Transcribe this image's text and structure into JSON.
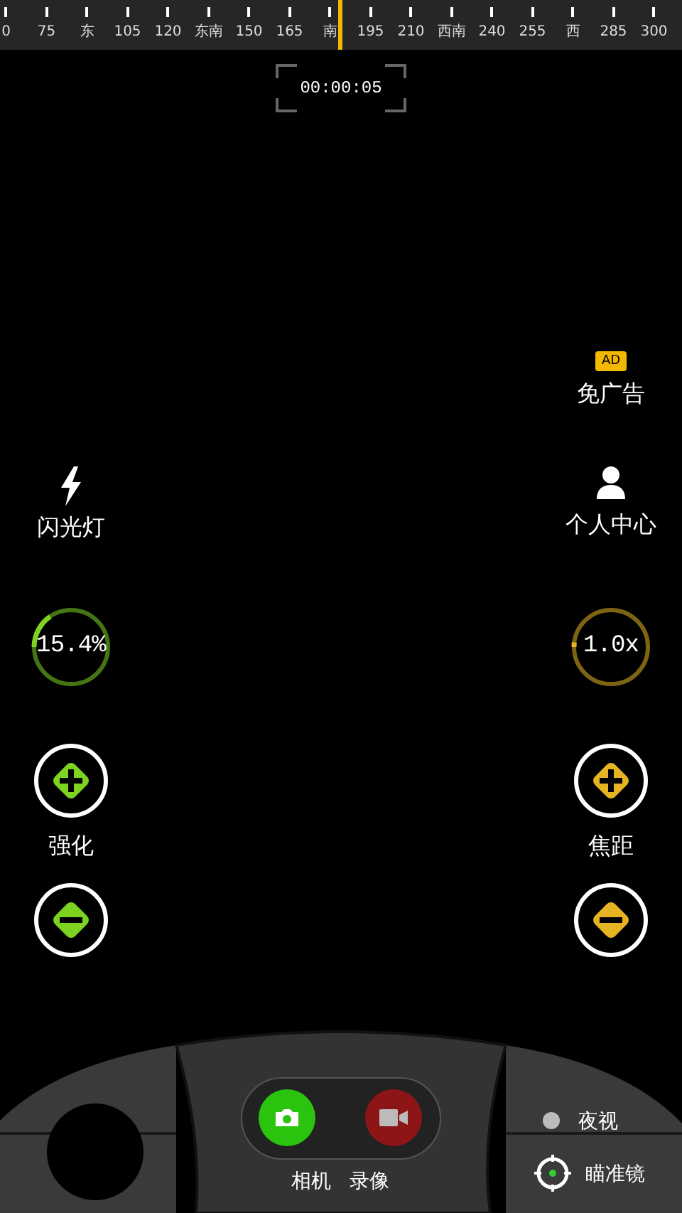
{
  "compass": {
    "labels": [
      "0",
      "75",
      "东",
      "105",
      "120",
      "东南",
      "150",
      "165",
      "南",
      "195",
      "210",
      "西南",
      "240",
      "255",
      "西",
      "285",
      "300"
    ]
  },
  "timer": "00:00:05",
  "ad": {
    "badge": "AD",
    "label": "免广告"
  },
  "flash": {
    "label": "闪光灯"
  },
  "profile": {
    "label": "个人中心"
  },
  "dials": [
    {
      "reading": "15.4%",
      "label": "强化",
      "color": "#7ed321"
    },
    {
      "reading": "1.0x",
      "label": "焦距",
      "color": "#e6b422"
    }
  ],
  "capture": {
    "photo_label": "相机",
    "video_label": "录像"
  },
  "night_vision": {
    "label": "夜视"
  },
  "scope": {
    "label": "瞄准镜"
  }
}
